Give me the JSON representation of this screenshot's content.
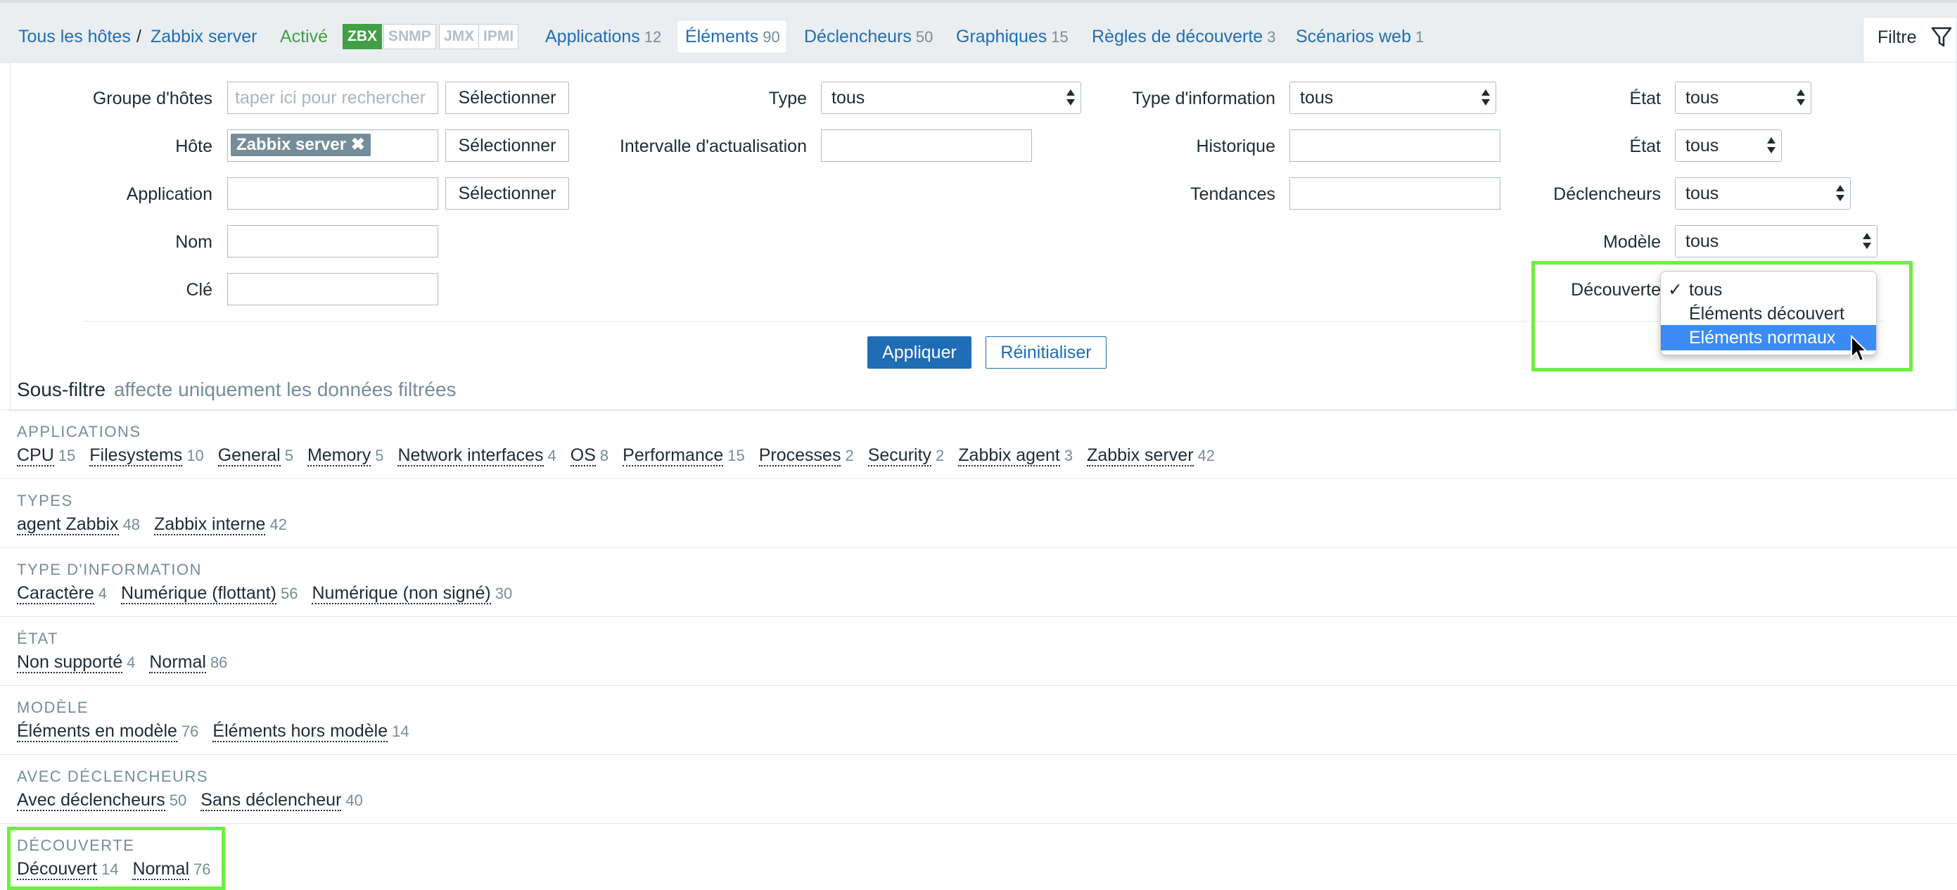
{
  "nav": {
    "all_hosts": "Tous les hôtes",
    "separator": "/",
    "host": "Zabbix server",
    "status": "Activé",
    "badges": [
      "ZBX",
      "SNMP",
      "JMX",
      "IPMI"
    ],
    "tabs": [
      {
        "label": "Applications",
        "count": "12"
      },
      {
        "label": "Éléments",
        "count": "90"
      },
      {
        "label": "Déclencheurs",
        "count": "50"
      },
      {
        "label": "Graphiques",
        "count": "15"
      },
      {
        "label": "Règles de découverte",
        "count": "3"
      },
      {
        "label": "Scénarios web",
        "count": "1"
      }
    ],
    "filter_label": "Filtre"
  },
  "filter": {
    "host_groups_label": "Groupe d'hôtes",
    "host_groups_placeholder": "taper ici pour rechercher",
    "select_label": "Sélectionner",
    "host_label": "Hôte",
    "host_chip": "Zabbix server",
    "application_label": "Application",
    "name_label": "Nom",
    "key_label": "Clé",
    "type_label": "Type",
    "type_value": "tous",
    "interval_label": "Intervalle d'actualisation",
    "info_type_label": "Type d'information",
    "info_type_value": "tous",
    "history_label": "Historique",
    "trends_label": "Tendances",
    "state_label": "État",
    "state_value": "tous",
    "status_label": "État",
    "status_value": "tous",
    "triggers_label": "Déclencheurs",
    "triggers_value": "tous",
    "template_label": "Modèle",
    "template_value": "tous",
    "discovery_label": "Découverte",
    "discovery_options": [
      "tous",
      "Éléments découvert",
      "Eléments normaux"
    ],
    "discovery_selected": "tous",
    "discovery_highlighted": "Eléments normaux",
    "apply": "Appliquer",
    "reset": "Réinitialiser"
  },
  "subfilter": {
    "title": "Sous-filtre",
    "hint": "affecte uniquement les données filtrées",
    "sections": [
      {
        "title": "APPLICATIONS",
        "items": [
          [
            "CPU",
            "15"
          ],
          [
            "Filesystems",
            "10"
          ],
          [
            "General",
            "5"
          ],
          [
            "Memory",
            "5"
          ],
          [
            "Network interfaces",
            "4"
          ],
          [
            "OS",
            "8"
          ],
          [
            "Performance",
            "15"
          ],
          [
            "Processes",
            "2"
          ],
          [
            "Security",
            "2"
          ],
          [
            "Zabbix agent",
            "3"
          ],
          [
            "Zabbix server",
            "42"
          ]
        ]
      },
      {
        "title": "TYPES",
        "items": [
          [
            "agent Zabbix",
            "48"
          ],
          [
            "Zabbix interne",
            "42"
          ]
        ]
      },
      {
        "title": "TYPE D'INFORMATION",
        "items": [
          [
            "Caractère",
            "4"
          ],
          [
            "Numérique (flottant)",
            "56"
          ],
          [
            "Numérique (non signé)",
            "30"
          ]
        ]
      },
      {
        "title": "ÉTAT",
        "items": [
          [
            "Non supporté",
            "4"
          ],
          [
            "Normal",
            "86"
          ]
        ]
      },
      {
        "title": "MODÈLE",
        "items": [
          [
            "Éléments en modèle",
            "76"
          ],
          [
            "Éléments hors modèle",
            "14"
          ]
        ]
      },
      {
        "title": "AVEC DÉCLENCHEURS",
        "items": [
          [
            "Avec déclencheurs",
            "50"
          ],
          [
            "Sans déclencheur",
            "40"
          ]
        ]
      },
      {
        "title": "DÉCOUVERTE",
        "items": [
          [
            "Découvert",
            "14"
          ],
          [
            "Normal",
            "76"
          ]
        ]
      }
    ]
  },
  "colors": {
    "link": "#1f6db5",
    "active": "#429e47",
    "highlight": "#6cf03e",
    "menu_highlight": "#3c8bf5"
  }
}
